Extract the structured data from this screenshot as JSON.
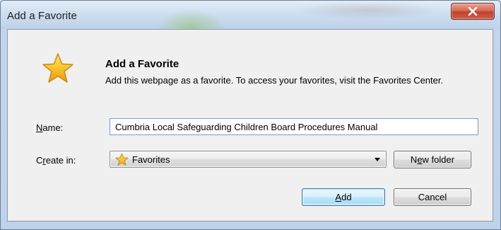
{
  "window": {
    "title": "Add a Favorite",
    "close_icon": "close-x-icon"
  },
  "dialog": {
    "icon": "favorite-star-icon",
    "heading": "Add a Favorite",
    "description": "Add this webpage as a favorite. To access your favorites, visit the Favorites Center."
  },
  "form": {
    "name_label_mnemonic": "N",
    "name_label_rest": "ame:",
    "name_value": "Cumbria Local Safeguarding Children Board Procedures Manual",
    "create_in_label_pre": "C",
    "create_in_label_mnemonic": "r",
    "create_in_label_rest": "eate in:",
    "create_in_value": "Favorites",
    "create_in_icon": "favorites-folder-star-icon"
  },
  "buttons": {
    "new_folder_pre": "N",
    "new_folder_mnemonic": "e",
    "new_folder_rest": "w folder",
    "add_mnemonic": "A",
    "add_rest": "dd",
    "cancel": "Cancel"
  },
  "colors": {
    "accent_star": "#f7c325",
    "close_button": "#c94a35",
    "default_button_border": "#3c7fb1"
  }
}
